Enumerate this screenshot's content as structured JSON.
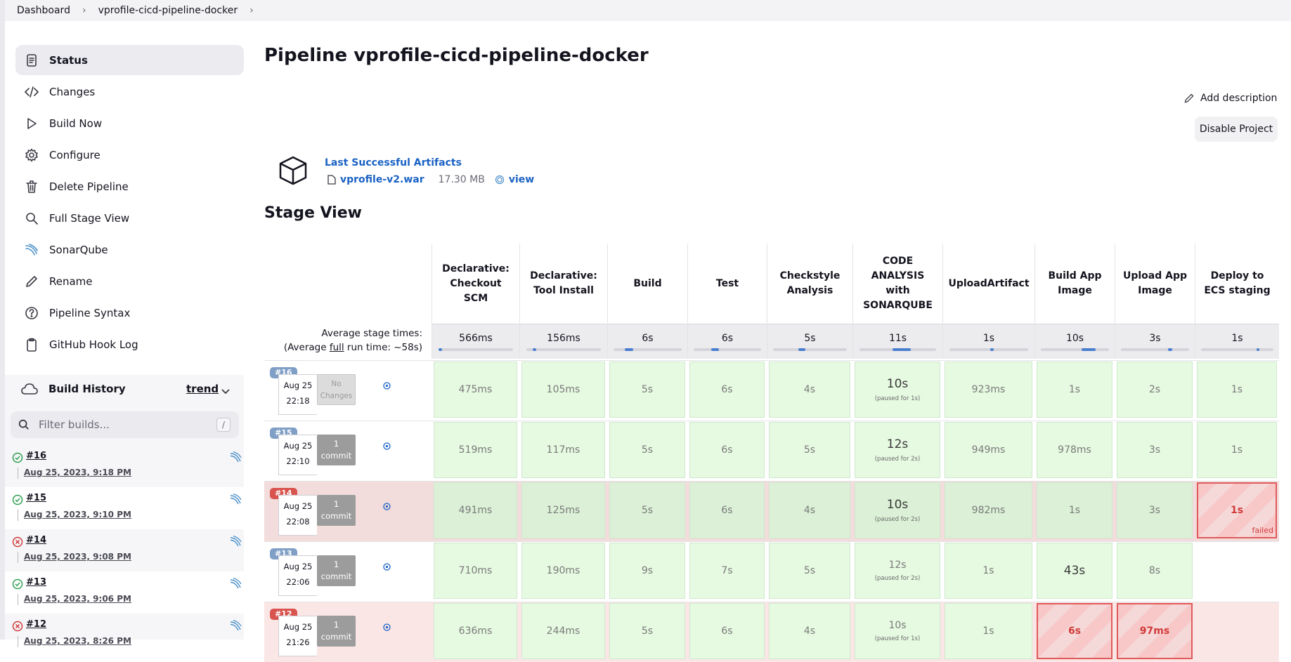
{
  "breadcrumb": {
    "items": [
      "Dashboard",
      "vprofile-cicd-pipeline-docker"
    ]
  },
  "sidebar": {
    "items": [
      {
        "label": "Status",
        "icon": "status-icon"
      },
      {
        "label": "Changes",
        "icon": "code-icon"
      },
      {
        "label": "Build Now",
        "icon": "play-icon"
      },
      {
        "label": "Configure",
        "icon": "gear-icon"
      },
      {
        "label": "Delete Pipeline",
        "icon": "trash-icon"
      },
      {
        "label": "Full Stage View",
        "icon": "search-icon"
      },
      {
        "label": "SonarQube",
        "icon": "sonarqube-icon"
      },
      {
        "label": "Rename",
        "icon": "pencil-icon"
      },
      {
        "label": "Pipeline Syntax",
        "icon": "help-icon"
      },
      {
        "label": "GitHub Hook Log",
        "icon": "clipboard-icon"
      }
    ]
  },
  "build_history": {
    "title": "Build History",
    "trend": "trend",
    "filter_placeholder": "Filter builds...",
    "filter_shortcut": "/",
    "builds": [
      {
        "number": "#16",
        "date": "Aug 25, 2023, 9:18 PM",
        "status": "success"
      },
      {
        "number": "#15",
        "date": "Aug 25, 2023, 9:10 PM",
        "status": "success"
      },
      {
        "number": "#14",
        "date": "Aug 25, 2023, 9:08 PM",
        "status": "failed"
      },
      {
        "number": "#13",
        "date": "Aug 25, 2023, 9:06 PM",
        "status": "success"
      },
      {
        "number": "#12",
        "date": "Aug 25, 2023, 8:26 PM",
        "status": "failed"
      }
    ]
  },
  "main": {
    "title": "Pipeline vprofile-cicd-pipeline-docker",
    "add_description": "Add description",
    "disable_project": "Disable Project",
    "artifacts": {
      "title": "Last Successful Artifacts",
      "file": "vprofile-v2.war",
      "size": "17.30 MB",
      "view": "view"
    },
    "stage_view_title": "Stage View",
    "avg_label_1": "Average stage times:",
    "avg_label_2a": "(Average ",
    "avg_label_2b": "full",
    "avg_label_2c": " run time: ~58s)"
  },
  "stages": [
    {
      "name": "Declarative: Checkout SCM",
      "avg": "566ms",
      "avg_fraction": 0.05
    },
    {
      "name": "Declarative: Tool Install",
      "avg": "156ms",
      "avg_fraction": 0.02
    },
    {
      "name": "Build",
      "avg": "6s",
      "avg_fraction": 0.12
    },
    {
      "name": "Test",
      "avg": "6s",
      "avg_fraction": 0.12
    },
    {
      "name": "Checkstyle Analysis",
      "avg": "5s",
      "avg_fraction": 0.1
    },
    {
      "name": "CODE ANALYSIS with SONARQUBE",
      "avg": "11s",
      "avg_fraction": 0.24
    },
    {
      "name": "UploadArtifact",
      "avg": "1s",
      "avg_fraction": 0.03
    },
    {
      "name": "Build App Image",
      "avg": "10s",
      "avg_fraction": 0.2
    },
    {
      "name": "Upload App Image",
      "avg": "3s",
      "avg_fraction": 0.06
    },
    {
      "name": "Deploy to ECS staging",
      "avg": "1s",
      "avg_fraction": 0.03
    }
  ],
  "runs": [
    {
      "badge": "#16",
      "badge_color": "#7f9fc6",
      "date": "Aug 25",
      "time": "22:18",
      "changes": "No Changes",
      "has_commit": false,
      "row_bg": "#ffffff",
      "cells": [
        {
          "v": "475ms"
        },
        {
          "v": "105ms"
        },
        {
          "v": "5s"
        },
        {
          "v": "6s"
        },
        {
          "v": "4s"
        },
        {
          "v": "10s",
          "p": "(paused for 1s)",
          "big": true
        },
        {
          "v": "923ms"
        },
        {
          "v": "1s"
        },
        {
          "v": "2s"
        },
        {
          "v": "1s"
        }
      ]
    },
    {
      "badge": "#15",
      "badge_color": "#7f9fc6",
      "date": "Aug 25",
      "time": "22:10",
      "changes_1": "1",
      "changes_2": "commit",
      "has_commit": true,
      "row_bg": "#ffffff",
      "cells": [
        {
          "v": "519ms"
        },
        {
          "v": "117ms"
        },
        {
          "v": "5s"
        },
        {
          "v": "6s"
        },
        {
          "v": "5s"
        },
        {
          "v": "12s",
          "p": "(paused for 2s)",
          "big": true
        },
        {
          "v": "949ms"
        },
        {
          "v": "978ms"
        },
        {
          "v": "3s"
        },
        {
          "v": "1s"
        }
      ]
    },
    {
      "badge": "#14",
      "badge_color": "#d9534f",
      "date": "Aug 25",
      "time": "22:08",
      "changes_1": "1",
      "changes_2": "commit",
      "has_commit": true,
      "row_bg": "#f2dcdc",
      "cells": [
        {
          "v": "491ms",
          "d": true
        },
        {
          "v": "125ms",
          "d": true
        },
        {
          "v": "5s",
          "d": true
        },
        {
          "v": "6s",
          "d": true
        },
        {
          "v": "4s",
          "d": true
        },
        {
          "v": "10s",
          "p": "(paused for 2s)",
          "big": true,
          "d": true
        },
        {
          "v": "982ms",
          "d": true
        },
        {
          "v": "1s",
          "d": true
        },
        {
          "v": "3s",
          "d": true
        },
        {
          "v": "1s",
          "fail": true,
          "fl": "failed"
        }
      ]
    },
    {
      "badge": "#13",
      "badge_color": "#7f9fc6",
      "date": "Aug 25",
      "time": "22:06",
      "changes_1": "1",
      "changes_2": "commit",
      "has_commit": true,
      "row_bg": "#ffffff",
      "cells": [
        {
          "v": "710ms"
        },
        {
          "v": "190ms"
        },
        {
          "v": "9s"
        },
        {
          "v": "7s"
        },
        {
          "v": "5s"
        },
        {
          "v": "12s",
          "p": "(paused for 2s)"
        },
        {
          "v": "1s"
        },
        {
          "v": "43s",
          "big": true
        },
        {
          "v": "8s"
        },
        {
          "v": null
        }
      ]
    },
    {
      "badge": "#12",
      "badge_color": "#d9534f",
      "date": "Aug 25",
      "time": "21:26",
      "changes_1": "1",
      "changes_2": "commit",
      "has_commit": true,
      "row_bg": "#fbe6e6",
      "cells": [
        {
          "v": "636ms"
        },
        {
          "v": "244ms"
        },
        {
          "v": "5s"
        },
        {
          "v": "6s"
        },
        {
          "v": "4s"
        },
        {
          "v": "10s",
          "p": "(paused for 1s)"
        },
        {
          "v": "1s"
        },
        {
          "v": "6s",
          "fail": true
        },
        {
          "v": "97ms",
          "fail": true
        },
        {
          "v": null
        }
      ]
    }
  ]
}
